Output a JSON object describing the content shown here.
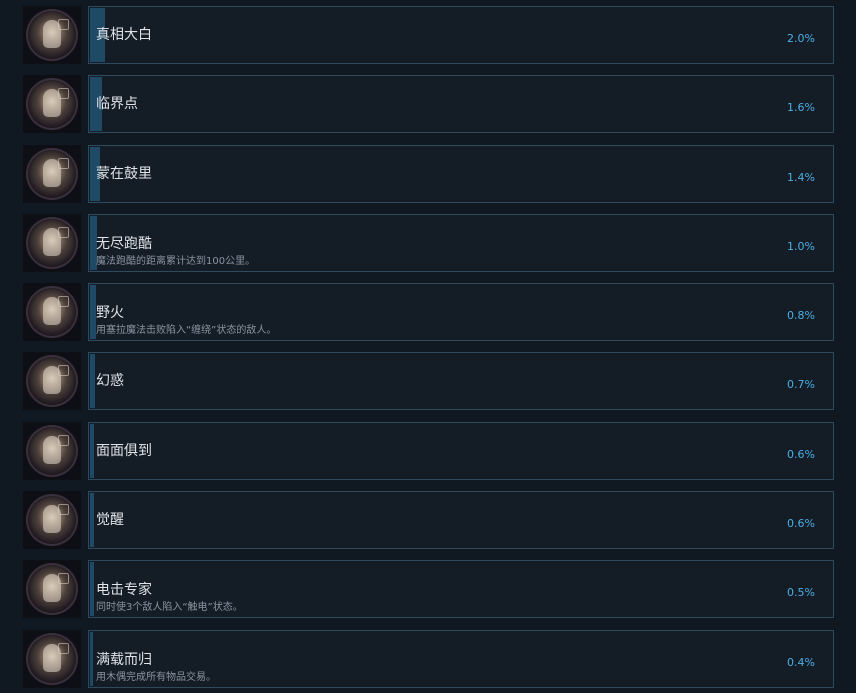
{
  "achievements": [
    {
      "title": "真相大白",
      "description": "",
      "percent": "2.0%",
      "percent_value": 2.0,
      "icon": "bald-monk-portrait-icon"
    },
    {
      "title": "临界点",
      "description": "",
      "percent": "1.6%",
      "percent_value": 1.6,
      "icon": "bald-monk-portrait-icon"
    },
    {
      "title": "蒙在鼓里",
      "description": "",
      "percent": "1.4%",
      "percent_value": 1.4,
      "icon": "drum-monk-icon"
    },
    {
      "title": "无尽跑酷",
      "description": "魔法跑酷的距离累计达到100公里。",
      "percent": "1.0%",
      "percent_value": 1.0,
      "icon": "parkour-figure-icon"
    },
    {
      "title": "野火",
      "description": "用塞拉魔法击败陷入“缠绕”状态的敌人。",
      "percent": "0.8%",
      "percent_value": 0.8,
      "icon": "wildfire-mage-icon"
    },
    {
      "title": "幻惑",
      "description": "",
      "percent": "0.7%",
      "percent_value": 0.7,
      "icon": "illusion-mage-icon"
    },
    {
      "title": "面面俱到",
      "description": "",
      "percent": "0.6%",
      "percent_value": 0.6,
      "icon": "mandala-emblem-icon"
    },
    {
      "title": "觉醒",
      "description": "",
      "percent": "0.6%",
      "percent_value": 0.6,
      "icon": "awakening-bird-icon"
    },
    {
      "title": "电击专家",
      "description": "同时使3个敌人陷入“触电”状态。",
      "percent": "0.5%",
      "percent_value": 0.5,
      "icon": "lightning-mage-icon"
    },
    {
      "title": "满载而归",
      "description": "用木偶完成所有物品交易。",
      "percent": "0.4%",
      "percent_value": 0.4,
      "icon": "puppet-merchant-icon"
    }
  ]
}
